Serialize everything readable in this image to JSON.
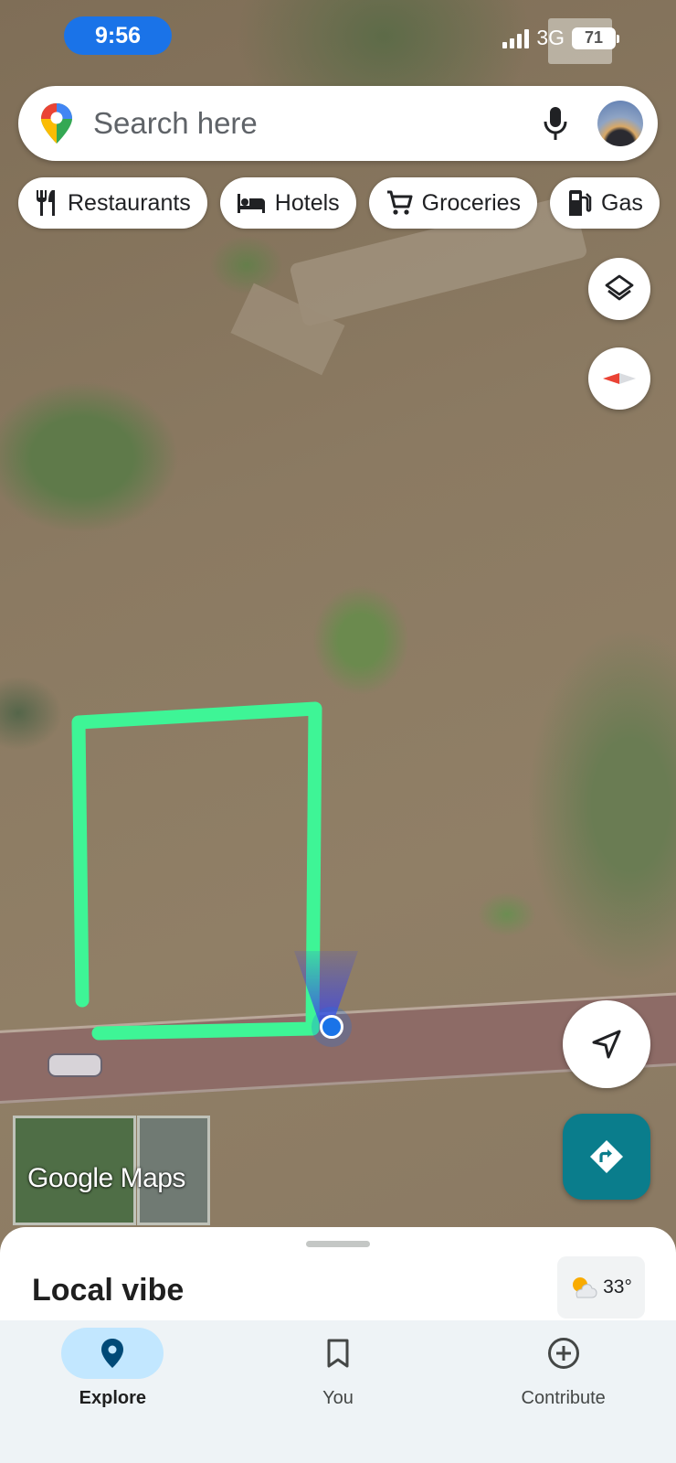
{
  "status_bar": {
    "time": "9:56",
    "network": "3G",
    "battery": "71"
  },
  "search": {
    "placeholder": "Search here"
  },
  "chips": [
    {
      "label": "Restaurants",
      "icon": "restaurant-icon"
    },
    {
      "label": "Hotels",
      "icon": "hotel-icon"
    },
    {
      "label": "Groceries",
      "icon": "cart-icon"
    },
    {
      "label": "Gas",
      "icon": "gas-station-icon"
    }
  ],
  "map": {
    "type": "satellite",
    "watermark": "Google Maps",
    "annotation_color": "#3ef596"
  },
  "sheet": {
    "title": "Local vibe",
    "weather": "33°"
  },
  "nav": [
    {
      "label": "Explore",
      "icon": "explore-pin-icon",
      "active": true
    },
    {
      "label": "You",
      "icon": "bookmark-icon",
      "active": false
    },
    {
      "label": "Contribute",
      "icon": "add-circle-icon",
      "active": false
    }
  ],
  "colors": {
    "accent": "#1a73e8",
    "directions": "#0a7d8c",
    "nav_active": "#c2e7ff"
  }
}
